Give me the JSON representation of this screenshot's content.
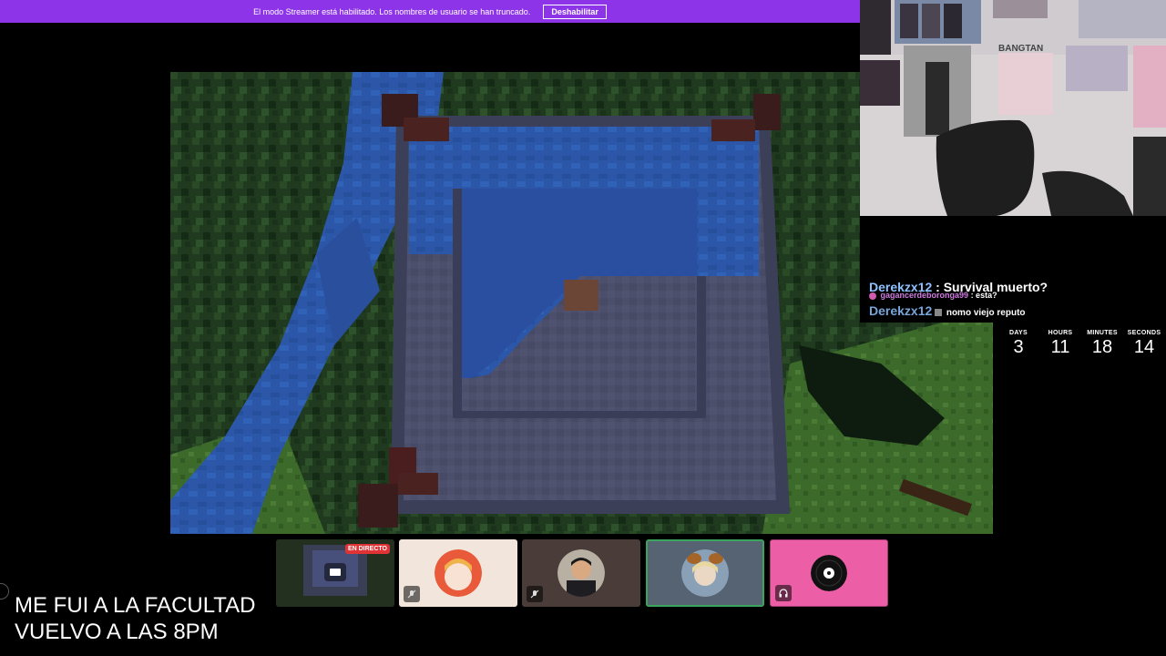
{
  "banner": {
    "message": "El modo Streamer está habilitado. Los nombres de usuario se han truncado.",
    "button_label": "Deshabilitar"
  },
  "chat": {
    "messages": [
      {
        "user": "Derekzx12",
        "text": ": Survival muerto?"
      },
      {
        "user": "gagancerdeboronga99",
        "text": ": esta?"
      },
      {
        "user": "Derekzx12",
        "text": "nomo viejo reputo"
      }
    ]
  },
  "countdown": {
    "days_label": "DAYS",
    "days": "3",
    "hours_label": "HOURS",
    "hours": "11",
    "minutes_label": "MINUTES",
    "minutes": "18",
    "seconds_label": "SECONDS",
    "seconds": "14"
  },
  "tiles": {
    "live_badge": "EN DIRECTO"
  },
  "away": {
    "line1": "ME FUI A LA FACULTAD",
    "line2": "VUELVO A LAS 8PM"
  },
  "webcam": {
    "poster_text": "BANGTAN"
  },
  "colors": {
    "banner": "#8e34e8",
    "live": "#e03336",
    "tile_speaking_border": "#3ba55d",
    "tile_pink": "#ec5fa6"
  }
}
